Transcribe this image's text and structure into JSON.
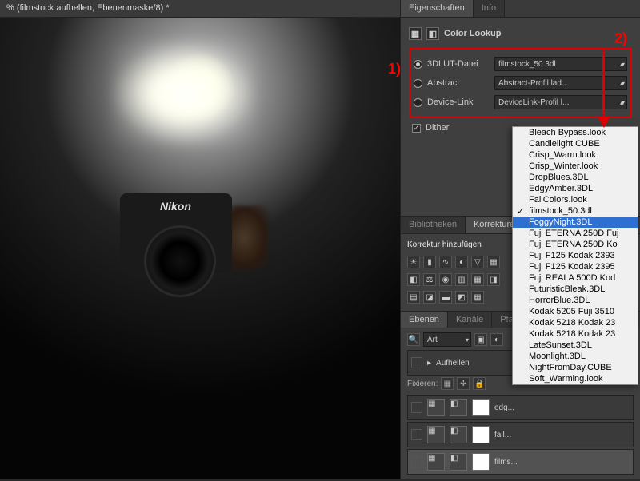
{
  "document": {
    "title": "% (filmstock aufhellen, Ebenenmaske/8) *"
  },
  "properties": {
    "tabs": [
      "Eigenschaften",
      "Info"
    ],
    "section_title": "Color Lookup",
    "radios": [
      {
        "label": "3DLUT-Datei",
        "value": "filmstock_50.3dl",
        "checked": true
      },
      {
        "label": "Abstract",
        "value": "Abstract-Profil lad...",
        "checked": false
      },
      {
        "label": "Device-Link",
        "value": "DeviceLink-Profil l...",
        "checked": false
      }
    ],
    "dither_label": "Dither",
    "dither_checked": true
  },
  "annotations": {
    "one": "1)",
    "two": "2)"
  },
  "bibliothek": {
    "tabs": [
      "Bibliotheken",
      "Korrekturen"
    ],
    "add_label": "Korrektur hinzufügen"
  },
  "layers_panel": {
    "tabs": [
      "Ebenen",
      "Kanäle",
      "Pfade"
    ],
    "blend_search": "Art",
    "lock_label": "Fixieren:",
    "layers": [
      {
        "name": "Aufhellen",
        "selected": false,
        "group": true
      },
      {
        "name": "edg...",
        "selected": false
      },
      {
        "name": "fall...",
        "selected": false
      },
      {
        "name": "films...",
        "selected": true
      }
    ]
  },
  "lut_list": {
    "items": [
      "Bleach Bypass.look",
      "Candlelight.CUBE",
      "Crisp_Warm.look",
      "Crisp_Winter.look",
      "DropBlues.3DL",
      "EdgyAmber.3DL",
      "FallColors.look",
      "filmstock_50.3dl",
      "FoggyNight.3DL",
      "Fuji ETERNA 250D Fuj",
      "Fuji ETERNA 250D Ko",
      "Fuji F125 Kodak 2393",
      "Fuji F125 Kodak 2395",
      "Fuji REALA 500D Kod",
      "FuturisticBleak.3DL",
      "HorrorBlue.3DL",
      "Kodak 5205 Fuji 3510",
      "Kodak 5218 Kodak 23",
      "Kodak 5218 Kodak 23",
      "LateSunset.3DL",
      "Moonlight.3DL",
      "NightFromDay.CUBE",
      "Soft_Warming.look"
    ],
    "checked_index": 7,
    "selected_index": 8
  },
  "camera": {
    "brand": "Nikon"
  }
}
